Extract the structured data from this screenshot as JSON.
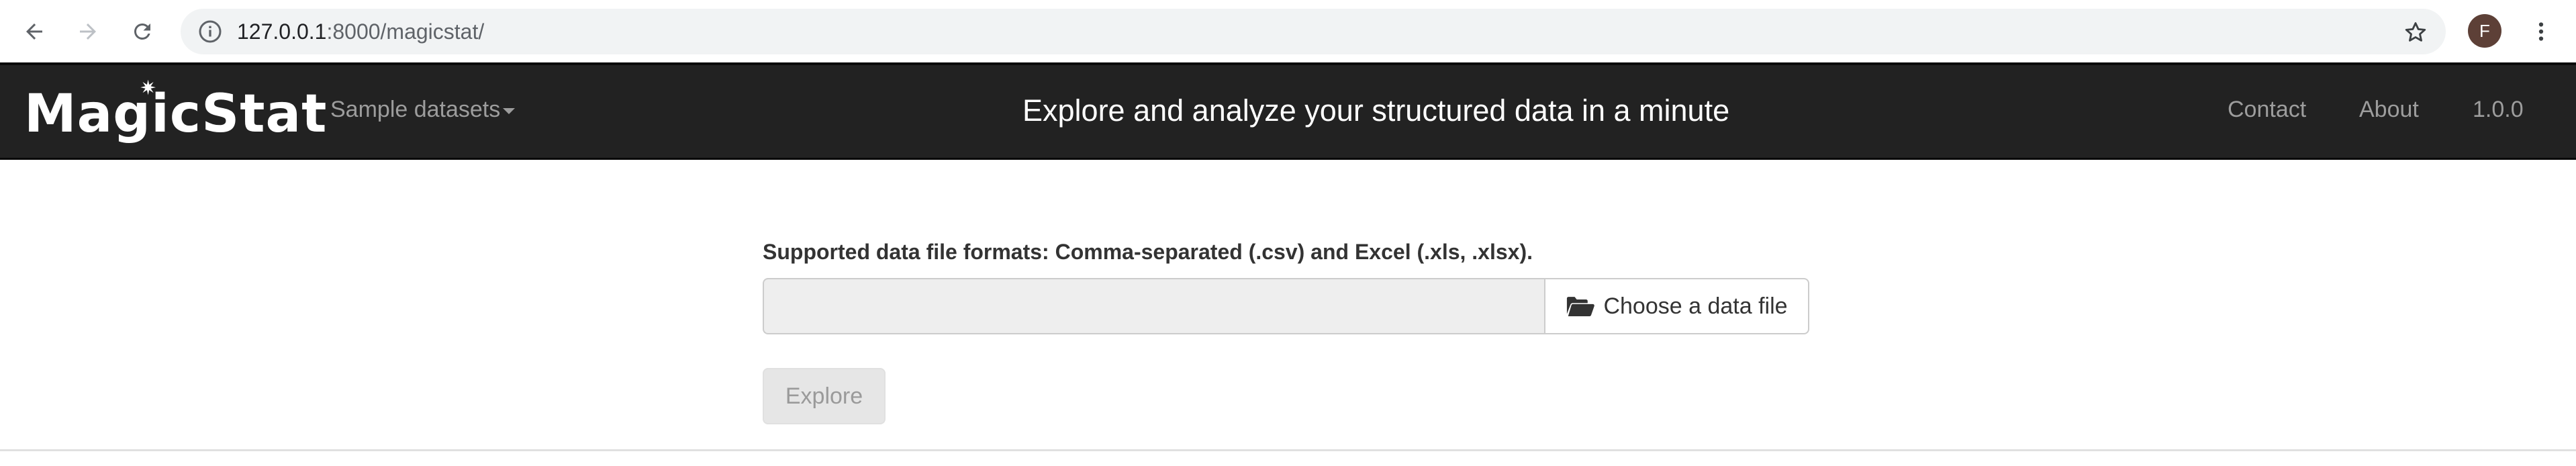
{
  "browser": {
    "url_host": "127.0.0.1",
    "url_rest": ":8000/magicstat/",
    "profile_initial": "F"
  },
  "navbar": {
    "brand": "MagicStat",
    "brand_part1": "Magic",
    "brand_part2": "Stat",
    "sample_datasets": "Sample datasets",
    "tagline": "Explore and analyze your structured data in a minute",
    "contact": "Contact",
    "about": "About",
    "version": "1.0.0"
  },
  "form": {
    "formats_label": "Supported data file formats: Comma-separated (.csv) and Excel (.xls, .xlsx).",
    "file_value": "",
    "choose_file_label": "Choose a data file",
    "explore_label": "Explore"
  },
  "icons": {
    "back": "back-arrow-icon",
    "forward": "forward-arrow-icon",
    "reload": "reload-icon",
    "info": "info-icon",
    "star": "star-icon",
    "menu": "more-vert-icon",
    "folder": "folder-open-icon",
    "caret": "caret-down-icon"
  },
  "colors": {
    "navbar_bg": "#222222",
    "navbar_link": "#9d9d9d",
    "avatar_bg": "#5d4037",
    "input_bg": "#eeeeee"
  }
}
